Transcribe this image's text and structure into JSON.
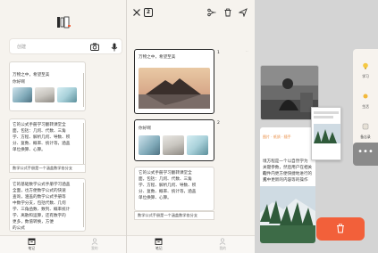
{
  "colors": {
    "accent": "#f2603a",
    "background": "#f6f3ee",
    "selected_border": "#2a2a2a",
    "tag_orange": "#e8873a"
  },
  "search": {
    "placeholder": "创建"
  },
  "notes": {
    "travel_title": "万物之中，希望至美",
    "travel_sub": "你好啊",
    "formula_lines": [
      "它的公式手册学习翻转课堂全",
      "面，包括：几何、代数、三角",
      "学、方程、解析几何、导数、积",
      "分、复数、概率、统计等，涵盖",
      "单位换算、心算。"
    ],
    "formula_tail": "数学公式手册是一个涵盖数学各分支",
    "math_lines": [
      "它的基础数学公式手册学习涵盖",
      "全面，也方便数学公式的快速",
      "查询，涵盖的数学公式手册等",
      "中数学分支，包括代数、几何",
      "学、三角函数、数列、概率统计",
      "学、离散和运算，还有数字的",
      "更多，数值转换，方便",
      "的公式"
    ]
  },
  "panel2": {
    "selected_count": "2",
    "card1_title": "万物之中，希望至美",
    "card2_title": "你好啊",
    "card3_lines": [
      "它的公式手册学习翻转课堂全",
      "面，包括：几何、代数、三角",
      "学、方程、解析几何、导数、积",
      "分、复数、概率、统计等，涵盖",
      "单位换算、心算。"
    ],
    "card3_tail": "数学公式手册是一个涵盖数学各分支",
    "num1": "1",
    "num2": "2"
  },
  "panel3": {
    "tag": "图片 · 纸质 · 随手",
    "card_lines": [
      "境方程是一个以自然学为",
      "关键参数，然后用户在相关的",
      "软件内更方便快捷地进行的方",
      "式中更新的内容等的操作"
    ],
    "side_items": [
      "学习",
      "生活",
      "备忘录"
    ],
    "more": "•••"
  },
  "tabs": {
    "notes": "笔记",
    "me": "我的"
  }
}
